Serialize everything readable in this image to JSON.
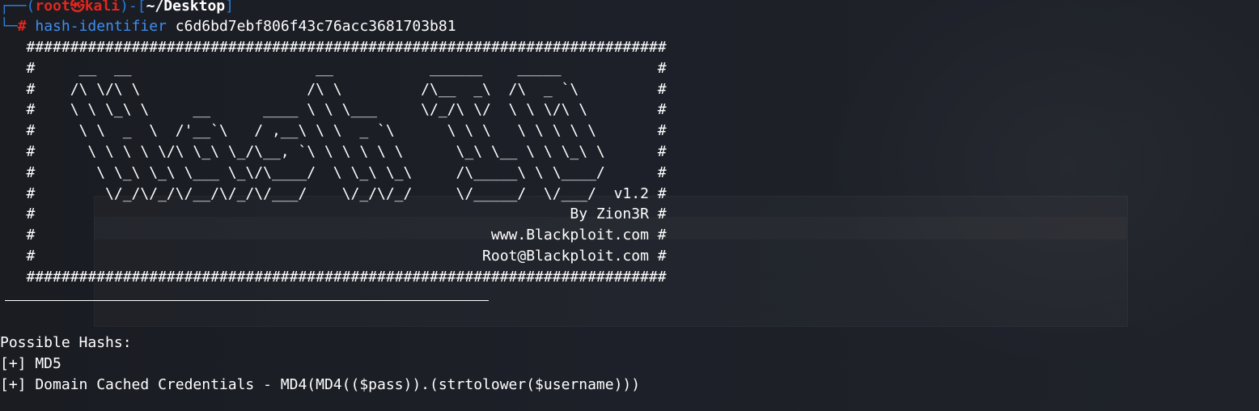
{
  "prompt": {
    "corner_top": "┌──(",
    "user": "root",
    "at_symbol": "㉿",
    "host": "kali",
    "separator": ")-[",
    "path": "~/Desktop",
    "close_bracket": "]",
    "corner_bottom": "└─",
    "hash_symbol": "#",
    "command": "hash-identifier",
    "argument": "c6d6bd7ebf806f43c76acc3681703b81"
  },
  "banner": {
    "lines": [
      "   #########################################################################",
      "   #     __  __                     __           ______    _____           #",
      "   #    /\\ \\/\\ \\                   /\\ \\         /\\__  _\\  /\\  _ `\\         #",
      "   #    \\ \\ \\_\\ \\     __      ____ \\ \\ \\___     \\/_/\\ \\/  \\ \\ \\/\\ \\        #",
      "   #     \\ \\  _  \\  /'__`\\   / ,__\\ \\ \\  _ `\\      \\ \\ \\   \\ \\ \\ \\ \\       #",
      "   #      \\ \\ \\ \\ \\/\\ \\_\\ \\_/\\__, `\\ \\ \\ \\ \\ \\      \\_\\ \\__ \\ \\ \\_\\ \\      #",
      "   #       \\ \\_\\ \\_\\ \\___ \\_\\/\\____/  \\ \\_\\ \\_\\     /\\_____\\ \\ \\____/      #",
      "   #        \\/_/\\/_/\\/__/\\/_/\\/___/    \\/_/\\/_/     \\/_____/  \\/___/  v1.2 #",
      "   #                                                             By Zion3R #",
      "   #                                                    www.Blackploit.com #",
      "   #                                                   Root@Blackploit.com #",
      "   #########################################################################"
    ]
  },
  "results": {
    "heading": "Possible Hashs:",
    "items": [
      "[+] MD5",
      "[+] Domain Cached Credentials - MD4(MD4(($pass)).(strtolower($username)))"
    ]
  },
  "colors": {
    "background": "#1b1d24",
    "prompt_frame": "#2d7cd9",
    "user_host": "#e3261d",
    "command": "#3e8ef0",
    "text": "#ffffff"
  }
}
